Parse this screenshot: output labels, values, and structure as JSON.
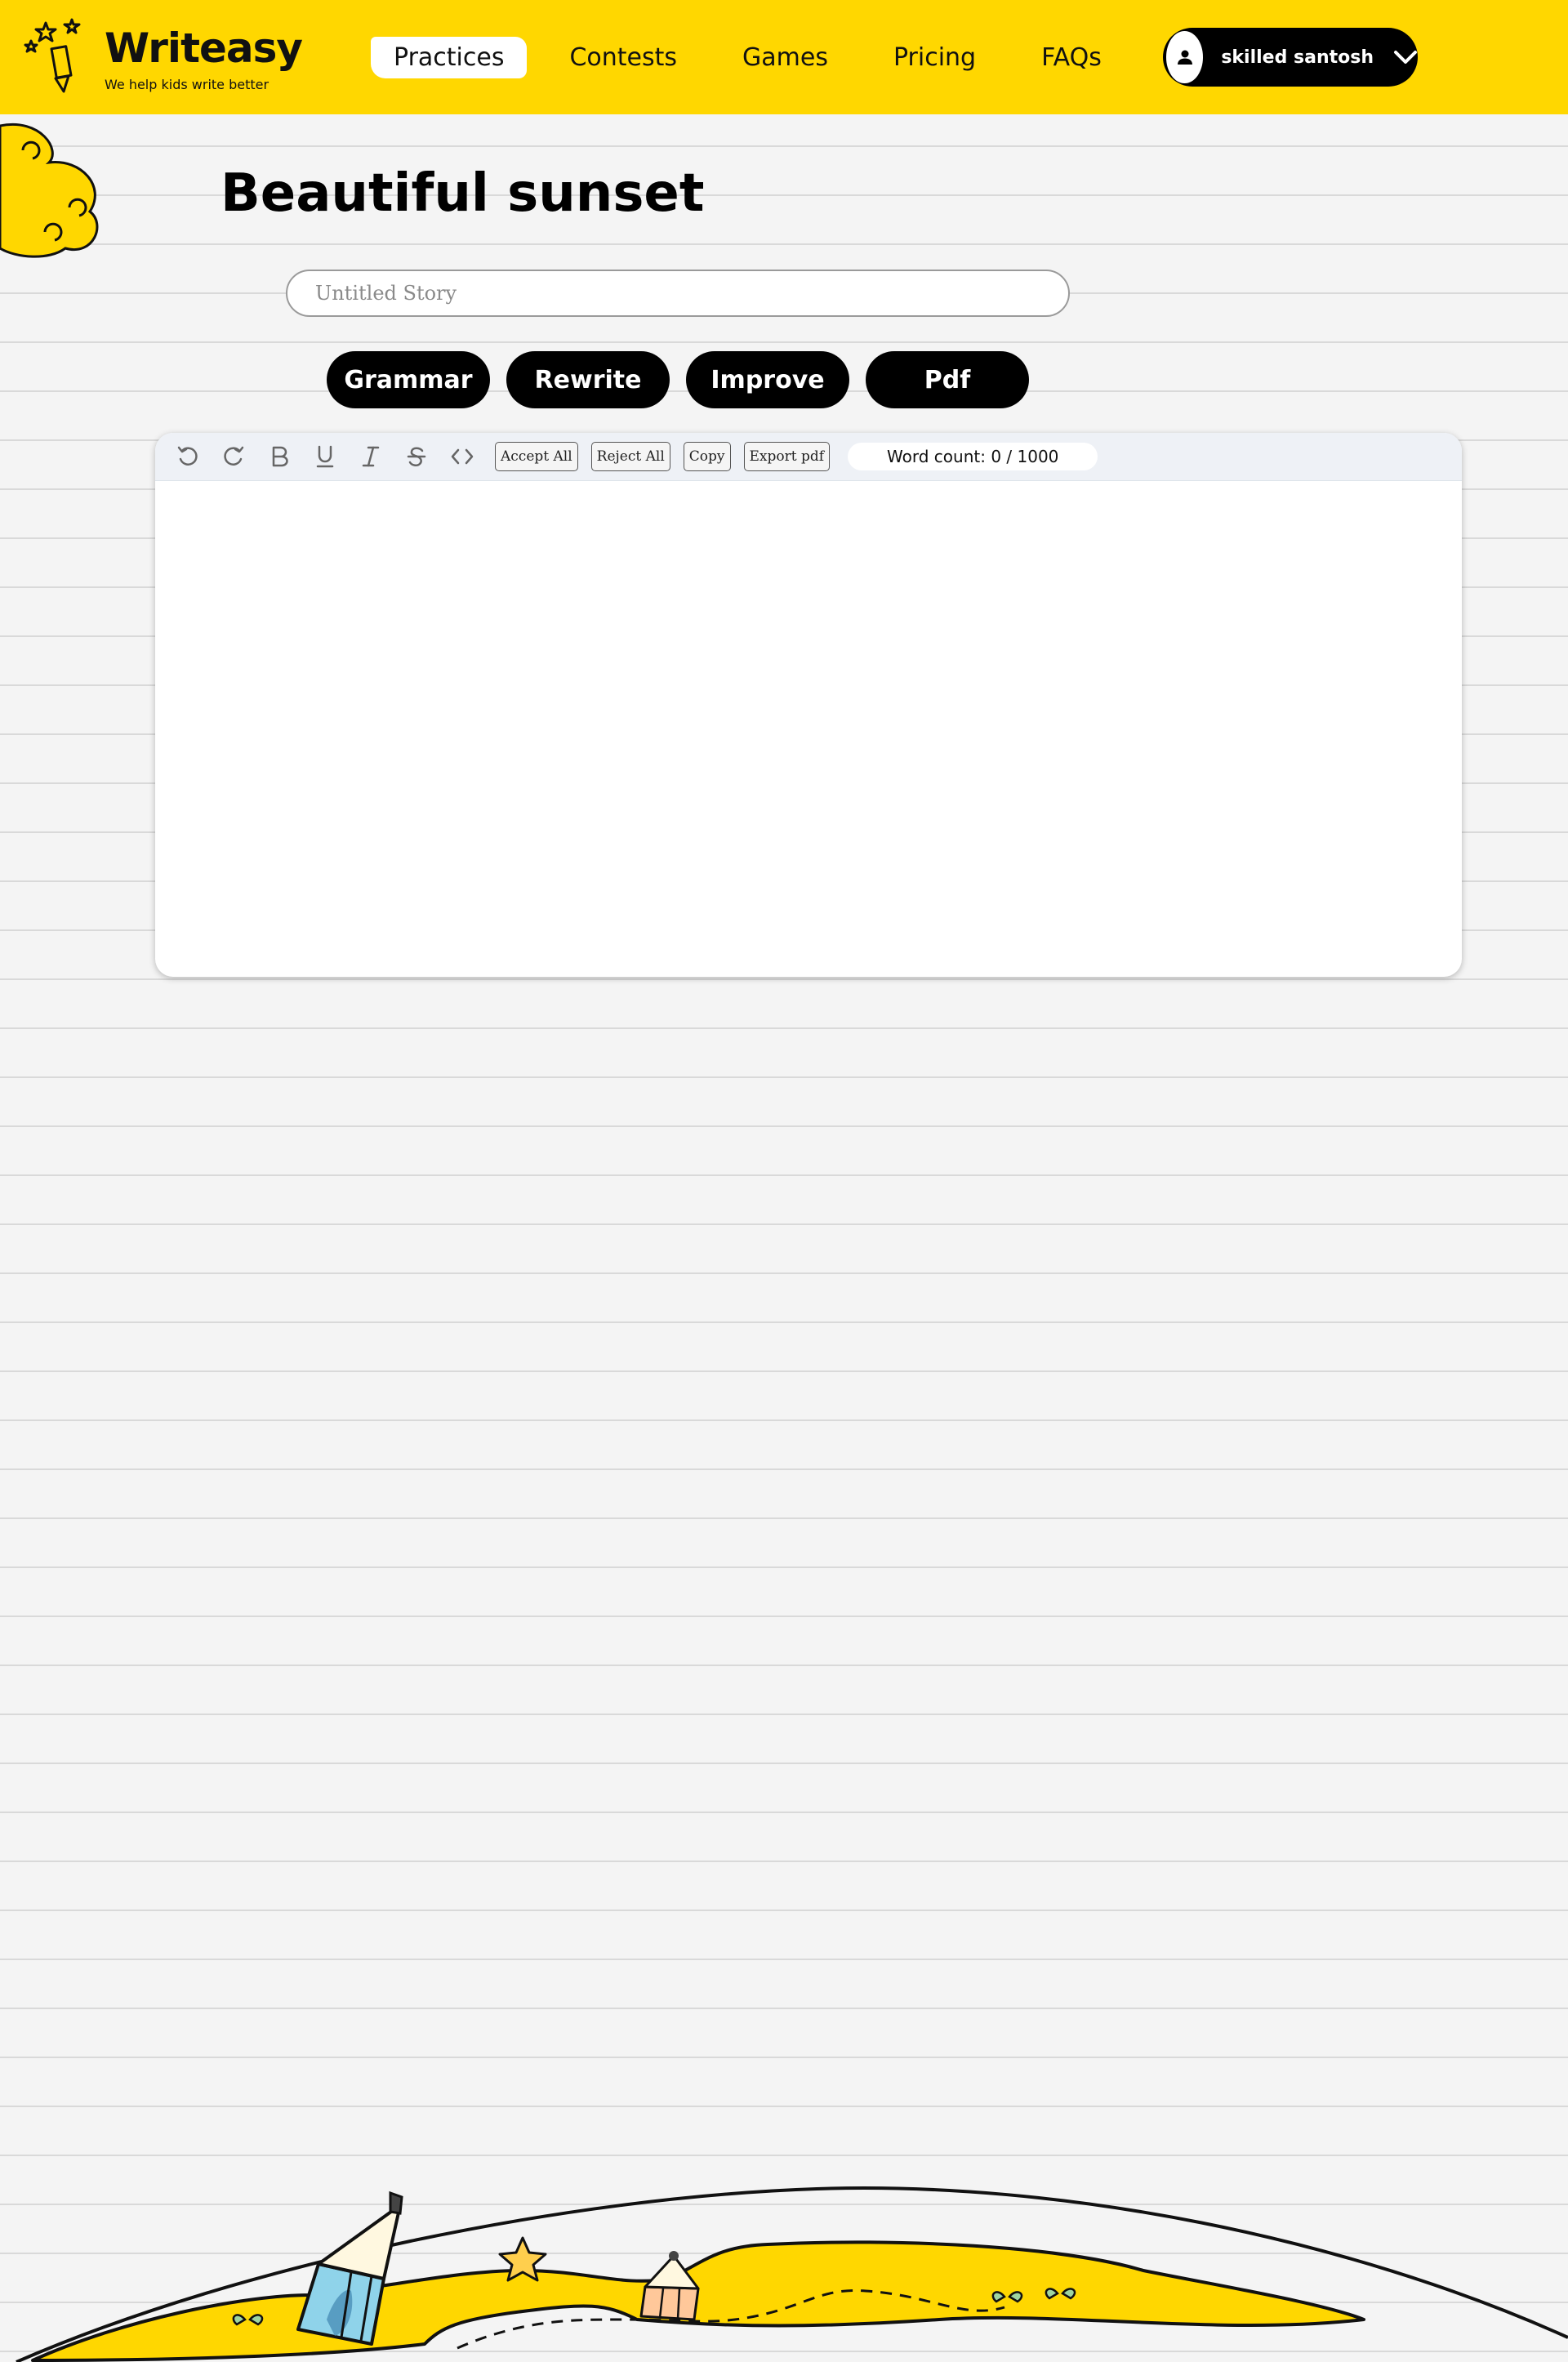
{
  "brand": {
    "name": "Writeasy",
    "tagline": "We help kids write better",
    "accent_color": "#ffd700"
  },
  "nav": {
    "items": [
      {
        "label": "Practices",
        "active": true
      },
      {
        "label": "Contests",
        "active": false
      },
      {
        "label": "Games",
        "active": false
      },
      {
        "label": "Pricing",
        "active": false
      },
      {
        "label": "FAQs",
        "active": false
      }
    ]
  },
  "user": {
    "name": "skilled santosh",
    "avatar_icon": "user-icon",
    "menu_icon": "chevron-down-icon"
  },
  "page": {
    "title": "Beautiful sunset"
  },
  "story": {
    "placeholder": "Untitled Story",
    "value": ""
  },
  "actions": {
    "grammar": "Grammar",
    "rewrite": "Rewrite",
    "improve": "Improve",
    "pdf": "Pdf"
  },
  "editor": {
    "toolbar_icons": [
      "undo-icon",
      "redo-icon",
      "bold-icon",
      "underline-icon",
      "italic-icon",
      "strikethrough-icon",
      "code-icon"
    ],
    "accept_all": "Accept All",
    "reject_all": "Reject All",
    "copy": "Copy",
    "export_pdf": "Export pdf",
    "word_count": "Word count: 0 / 1000",
    "content": ""
  }
}
